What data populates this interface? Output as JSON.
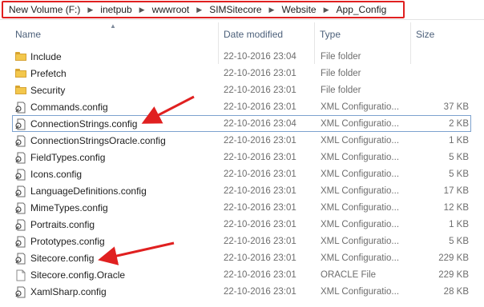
{
  "breadcrumb": [
    "New Volume (F:)",
    "inetpub",
    "wwwroot",
    "SIMSitecore",
    "Website",
    "App_Config"
  ],
  "columns": {
    "name": "Name",
    "date": "Date modified",
    "type": "Type",
    "size": "Size"
  },
  "files": [
    {
      "name": "Include",
      "date": "22-10-2016 23:04",
      "type": "File folder",
      "size": "",
      "icon": "folder-icon"
    },
    {
      "name": "Prefetch",
      "date": "22-10-2016 23:01",
      "type": "File folder",
      "size": "",
      "icon": "folder-icon"
    },
    {
      "name": "Security",
      "date": "22-10-2016 23:01",
      "type": "File folder",
      "size": "",
      "icon": "folder-icon"
    },
    {
      "name": "Commands.config",
      "date": "22-10-2016 23:01",
      "type": "XML Configuratio...",
      "size": "37 KB",
      "icon": "config-file-icon"
    },
    {
      "name": "ConnectionStrings.config",
      "date": "22-10-2016 23:04",
      "type": "XML Configuratio...",
      "size": "2 KB",
      "icon": "config-file-icon",
      "selected": true
    },
    {
      "name": "ConnectionStringsOracle.config",
      "date": "22-10-2016 23:01",
      "type": "XML Configuratio...",
      "size": "1 KB",
      "icon": "config-file-icon"
    },
    {
      "name": "FieldTypes.config",
      "date": "22-10-2016 23:01",
      "type": "XML Configuratio...",
      "size": "5 KB",
      "icon": "config-file-icon"
    },
    {
      "name": "Icons.config",
      "date": "22-10-2016 23:01",
      "type": "XML Configuratio...",
      "size": "5 KB",
      "icon": "config-file-icon"
    },
    {
      "name": "LanguageDefinitions.config",
      "date": "22-10-2016 23:01",
      "type": "XML Configuratio...",
      "size": "17 KB",
      "icon": "config-file-icon"
    },
    {
      "name": "MimeTypes.config",
      "date": "22-10-2016 23:01",
      "type": "XML Configuratio...",
      "size": "12 KB",
      "icon": "config-file-icon"
    },
    {
      "name": "Portraits.config",
      "date": "22-10-2016 23:01",
      "type": "XML Configuratio...",
      "size": "1 KB",
      "icon": "config-file-icon"
    },
    {
      "name": "Prototypes.config",
      "date": "22-10-2016 23:01",
      "type": "XML Configuratio...",
      "size": "5 KB",
      "icon": "config-file-icon"
    },
    {
      "name": "Sitecore.config",
      "date": "22-10-2016 23:01",
      "type": "XML Configuratio...",
      "size": "229 KB",
      "icon": "config-file-icon"
    },
    {
      "name": "Sitecore.config.Oracle",
      "date": "22-10-2016 23:01",
      "type": "ORACLE File",
      "size": "229 KB",
      "icon": "blank-file-icon"
    },
    {
      "name": "XamlSharp.config",
      "date": "22-10-2016 23:01",
      "type": "XML Configuratio...",
      "size": "28 KB",
      "icon": "config-file-icon"
    }
  ],
  "colors": {
    "highlight": "#e02020",
    "selection_border": "#7da2ce",
    "header_text": "#4c607a",
    "folder": "#f3c74c"
  }
}
